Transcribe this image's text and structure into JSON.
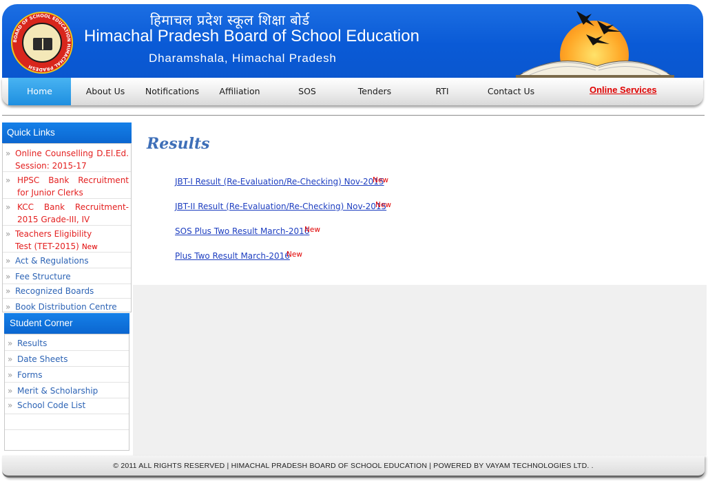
{
  "header": {
    "hindi_title": "हिमाचल प्रदेश स्कूल शिक्षा बोर्ड",
    "title": "Himachal Pradesh Board of School Education",
    "location": "Dharamshala, Himachal Pradesh",
    "logo_text": "BOARD OF SCHOOL EDUCATION HIMACHAL PRADESH"
  },
  "nav": {
    "items": [
      {
        "label": "Home"
      },
      {
        "label": "About Us"
      },
      {
        "label": "Notifications"
      },
      {
        "label": "Affiliation"
      },
      {
        "label": "SOS"
      },
      {
        "label": "Tenders"
      },
      {
        "label": "RTI"
      },
      {
        "label": "Contact Us"
      }
    ],
    "online_services": "Online Services",
    "active": "Home"
  },
  "quick_links": {
    "title": "Quick Links",
    "items": [
      {
        "label": "Online Counselling D.El.Ed. Session: 2015-17",
        "color": "#e31e1e"
      },
      {
        "label": "HPSC Bank Recruitment for Junior Clerks",
        "color": "#e31e1e"
      },
      {
        "label": "KCC Bank Recruitment-2015 Grade-III, IV",
        "color": "#e31e1e"
      },
      {
        "label": "Teachers Eligibility Test (TET-2015)",
        "badge": "New",
        "color": "#e31e1e"
      },
      {
        "label": "Act & Regulations",
        "color": "#2c63b5"
      },
      {
        "label": "Fee Structure",
        "color": "#2c63b5"
      },
      {
        "label": "Recognized Boards",
        "color": "#2c63b5"
      },
      {
        "label": "Book Distribution Centre",
        "color": "#2c63b5"
      }
    ]
  },
  "student_corner": {
    "title": "Student Corner",
    "items": [
      {
        "label": "Results"
      },
      {
        "label": "Date Sheets"
      },
      {
        "label": "Forms"
      },
      {
        "label": "Merit & Scholarship"
      },
      {
        "label": "School Code List"
      }
    ]
  },
  "main": {
    "title": "Results",
    "results": [
      {
        "label": "JBT-I Result (Re-Evaluation/Re-Checking) Nov-2015",
        "badge": "New"
      },
      {
        "label": "JBT-II Result (Re-Evaluation/Re-Checking) Nov-2015",
        "badge": "New"
      },
      {
        "label": "SOS Plus Two Result March-2016",
        "badge": "New"
      },
      {
        "label": "Plus Two Result March-2016",
        "badge": "New"
      }
    ]
  },
  "footer": {
    "text": "© 2011 ALL RIGHTS RESERVED | HIMACHAL PRADESH BOARD OF SCHOOL EDUCATION | POWERED BY VAYAM TECHNOLOGIES LTD. ."
  },
  "colors": {
    "header_blue": "#0a5ad6",
    "link_blue": "#1d3ec0",
    "alert_red": "#e00000",
    "title_blue": "#3e6fb8"
  }
}
